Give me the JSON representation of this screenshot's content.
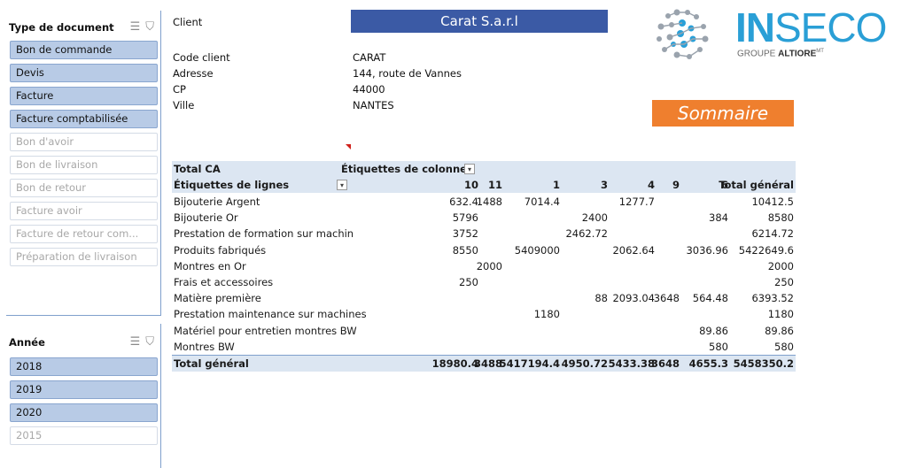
{
  "slicer_doc": {
    "title": "Type de document",
    "items": [
      {
        "label": "Bon de commande",
        "selected": true
      },
      {
        "label": "Devis",
        "selected": true
      },
      {
        "label": "Facture",
        "selected": true
      },
      {
        "label": "Facture comptabilisée",
        "selected": true
      },
      {
        "label": "Bon d'avoir",
        "selected": false
      },
      {
        "label": "Bon de livraison",
        "selected": false
      },
      {
        "label": "Bon de retour",
        "selected": false
      },
      {
        "label": "Facture avoir",
        "selected": false
      },
      {
        "label": "Facture de retour com...",
        "selected": false
      },
      {
        "label": "Préparation de livraison",
        "selected": false
      }
    ]
  },
  "slicer_year": {
    "title": "Année",
    "items": [
      {
        "label": "2018",
        "selected": true
      },
      {
        "label": "2019",
        "selected": true
      },
      {
        "label": "2020",
        "selected": true
      },
      {
        "label": "2015",
        "selected": false
      }
    ]
  },
  "client": {
    "client_label": "Client",
    "client_name": "Carat S.a.r.l",
    "code_label": "Code client",
    "code_value": "CARAT",
    "adresse_label": "Adresse",
    "adresse_value": "144, route de Vannes",
    "cp_label": "CP",
    "cp_value": "44000",
    "ville_label": "Ville",
    "ville_value": "NANTES"
  },
  "logo": {
    "brand_in": "IN",
    "brand_seco": "SECO",
    "tagline_a": "GROUPE ",
    "tagline_b": "ALTIORE",
    "tagline_sup": "MT"
  },
  "sommaire_label": "Sommaire",
  "colors": {
    "banner": "#3b5aa5",
    "sommaire": "#ef7f2e",
    "slicer_on": "#b8cbe6",
    "pivot_header": "#dce6f2",
    "logo_blue": "#2a9fd6"
  },
  "pivot": {
    "corner": "Total CA",
    "col_field": "Étiquettes de colonne",
    "row_field": "Étiquettes de lignes",
    "columns": [
      "10",
      "11",
      "1",
      "3",
      "4",
      "9",
      "6",
      "Total général"
    ],
    "rows": [
      {
        "label": "Bijouterie Argent",
        "cells": [
          "632.4",
          "1488",
          "7014.4",
          "",
          "1277.7",
          "",
          "",
          "10412.5"
        ]
      },
      {
        "label": "Bijouterie Or",
        "cells": [
          "5796",
          "",
          "",
          "2400",
          "",
          "",
          "384",
          "8580"
        ]
      },
      {
        "label": "Prestation de formation sur machin",
        "cells": [
          "3752",
          "",
          "",
          "2462.72",
          "",
          "",
          "",
          "6214.72"
        ]
      },
      {
        "label": "Produits fabriqués",
        "cells": [
          "8550",
          "",
          "5409000",
          "",
          "2062.64",
          "",
          "3036.96",
          "5422649.6"
        ]
      },
      {
        "label": "Montres en Or",
        "cells": [
          "",
          "2000",
          "",
          "",
          "",
          "",
          "",
          "2000"
        ]
      },
      {
        "label": "Frais et accessoires",
        "cells": [
          "250",
          "",
          "",
          "",
          "",
          "",
          "",
          "250"
        ]
      },
      {
        "label": "Matière première",
        "cells": [
          "",
          "",
          "",
          "88",
          "2093.04",
          "3648",
          "564.48",
          "6393.52"
        ]
      },
      {
        "label": "Prestation maintenance sur machines",
        "cells": [
          "",
          "",
          "1180",
          "",
          "",
          "",
          "",
          "1180"
        ]
      },
      {
        "label": "Matériel pour entretien montres BW",
        "cells": [
          "",
          "",
          "",
          "",
          "",
          "",
          "89.86",
          "89.86"
        ]
      },
      {
        "label": "Montres BW",
        "cells": [
          "",
          "",
          "",
          "",
          "",
          "",
          "580",
          "580"
        ]
      }
    ],
    "total": {
      "label": "Total général",
      "cells": [
        "18980.4",
        "3488",
        "5417194.4",
        "4950.72",
        "5433.38",
        "3648",
        "4655.3",
        "5458350.2"
      ]
    }
  }
}
